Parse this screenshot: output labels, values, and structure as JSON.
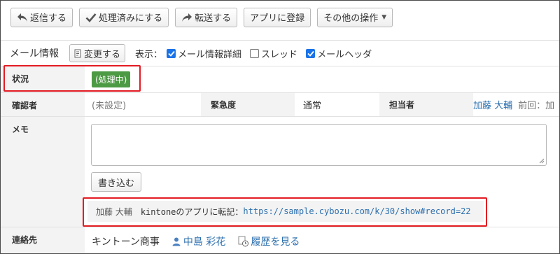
{
  "toolbar": {
    "reply": "返信する",
    "processed": "処理済みにする",
    "forward": "転送する",
    "register_app": "アプリに登録",
    "other_ops": "その他の操作"
  },
  "mail_info": {
    "title": "メール情報",
    "change_button": "変更する",
    "display_label": "表示：",
    "options": [
      {
        "label": "メール情報詳細",
        "checked": true
      },
      {
        "label": "スレッド",
        "checked": false
      },
      {
        "label": "メールヘッダ",
        "checked": true
      }
    ]
  },
  "fields": {
    "status_label": "状況",
    "status_value": "(処理中)",
    "confirmer_label": "確認者",
    "confirmer_value": "(未設定)",
    "urgency_label": "緊急度",
    "urgency_value": "通常",
    "assignee_label": "担当者",
    "assignee_value": "加藤 大輔",
    "previous_label": "前回：加",
    "memo_label": "メモ",
    "write_button": "書き込む",
    "note_author": "加藤 大輔",
    "note_text": "kintoneのアプリに転記：",
    "note_url": "https://sample.cybozu.com/k/30/show#record=22",
    "contact_label": "連絡先",
    "contact_company": "キントーン商事",
    "contact_person": "中島 彩花",
    "history_link": "履歴を見る"
  },
  "colors": {
    "status_badge": "#4d9a44",
    "link": "#2c6fae",
    "highlight": "#e31b23",
    "checkbox": "#1a73e8"
  }
}
